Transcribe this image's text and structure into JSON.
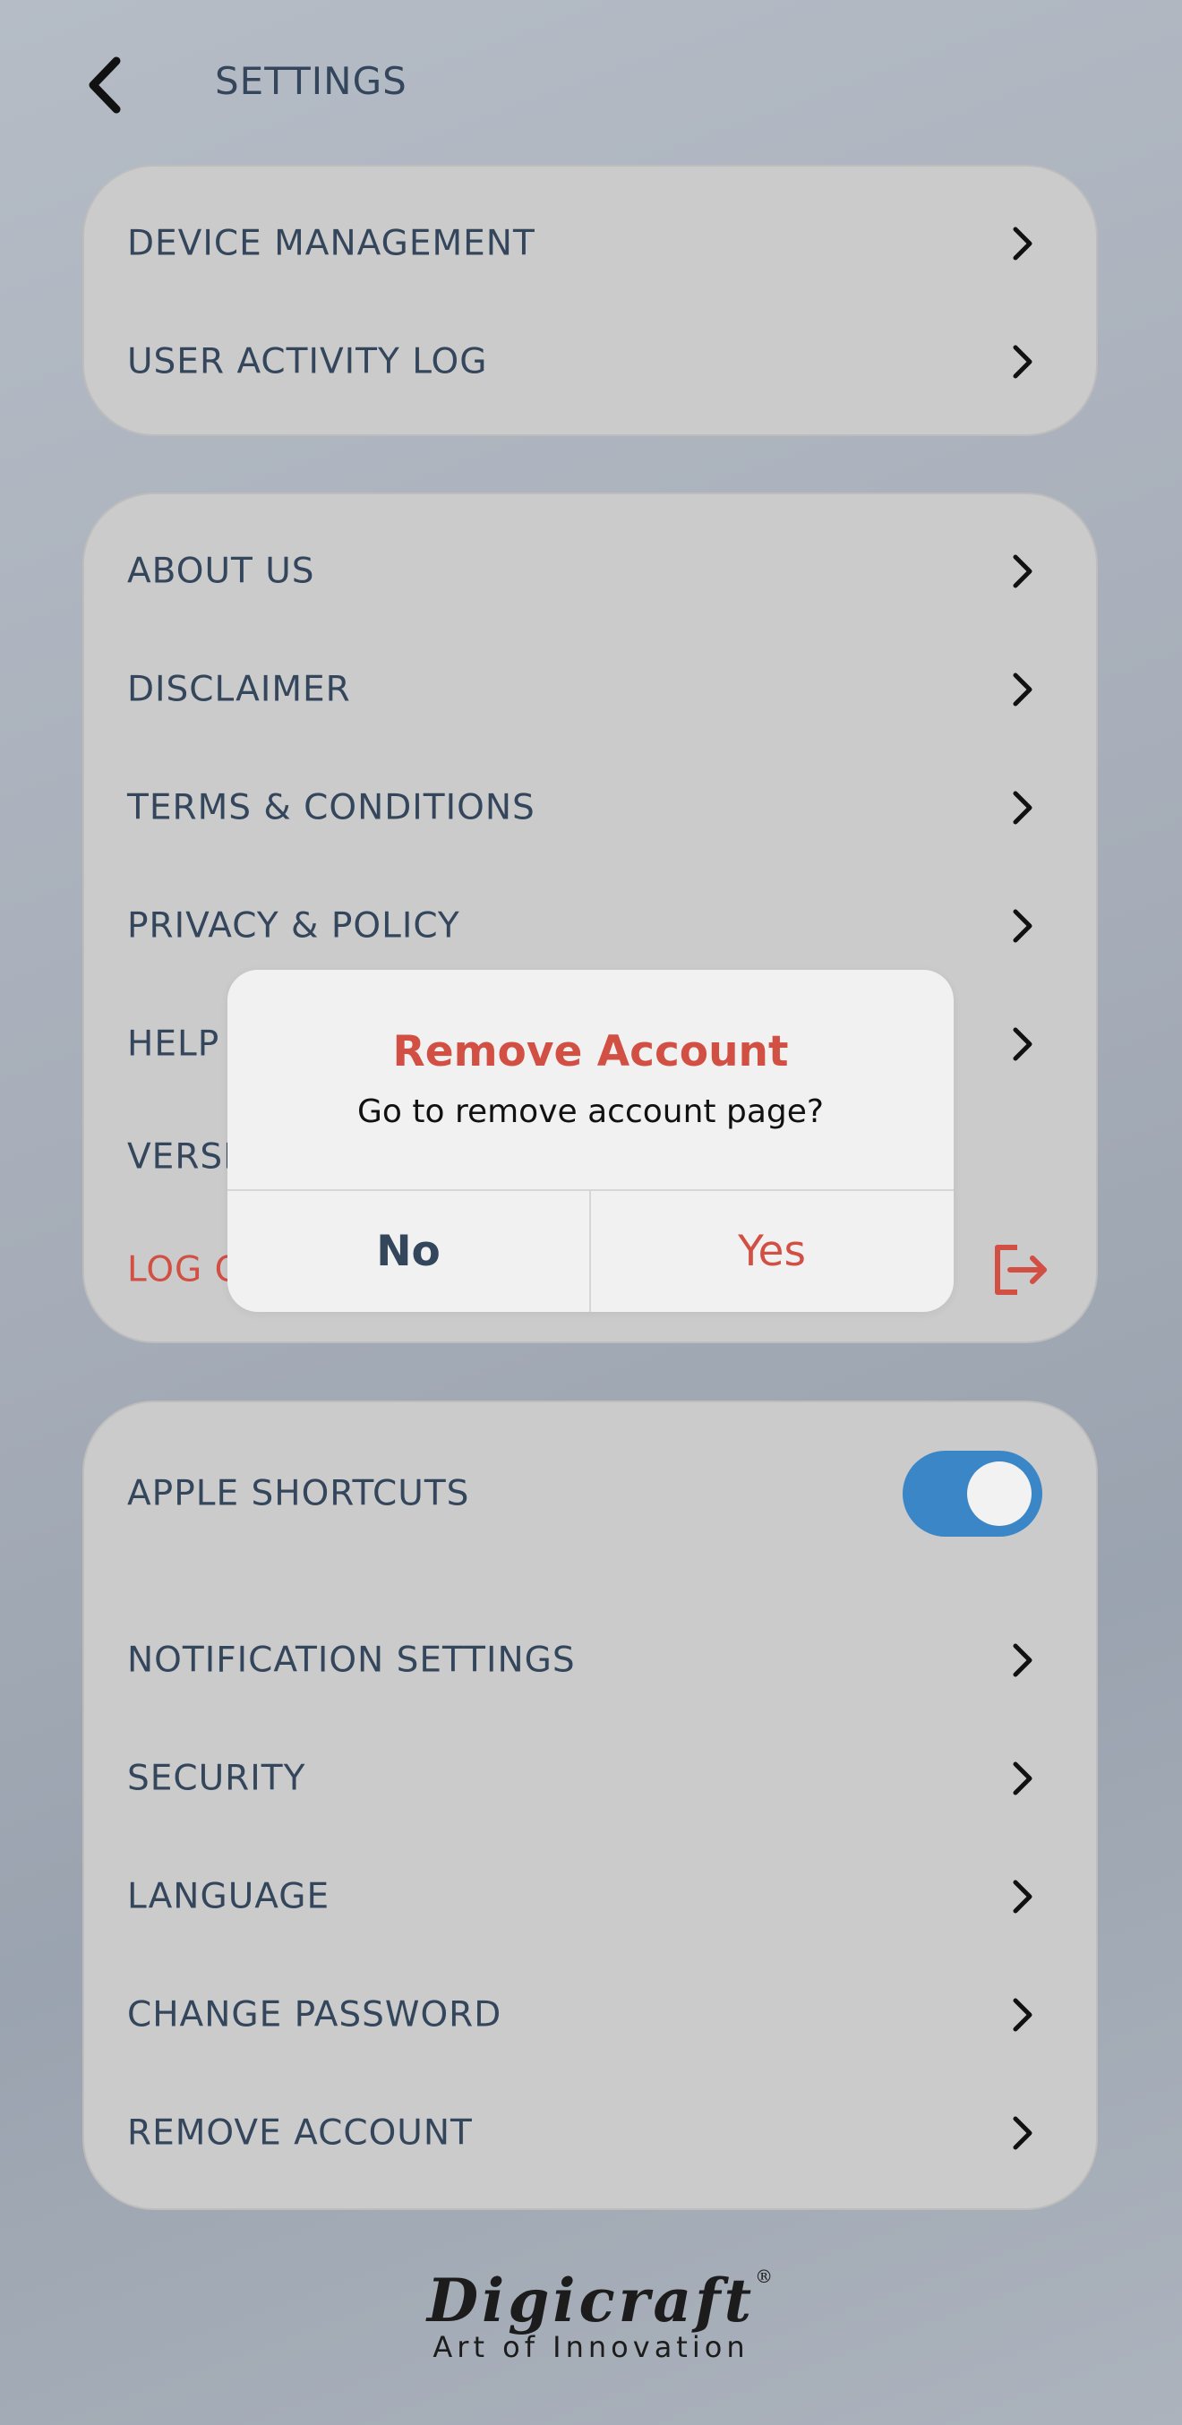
{
  "header": {
    "title": "SETTINGS"
  },
  "group1": {
    "items": [
      {
        "label": "DEVICE MANAGEMENT"
      },
      {
        "label": "USER ACTIVITY LOG"
      }
    ]
  },
  "group2": {
    "items": [
      {
        "label": "ABOUT US"
      },
      {
        "label": "DISCLAIMER"
      },
      {
        "label": "TERMS & CONDITIONS"
      },
      {
        "label": "PRIVACY & POLICY"
      },
      {
        "label": "HELP"
      },
      {
        "label": "VERSI"
      },
      {
        "label": "LOG O"
      }
    ]
  },
  "group3": {
    "apple_shortcuts": {
      "label": "APPLE SHORTCUTS",
      "enabled": true
    },
    "items": [
      {
        "label": "NOTIFICATION SETTINGS"
      },
      {
        "label": "SECURITY"
      },
      {
        "label": "LANGUAGE"
      },
      {
        "label": "CHANGE PASSWORD"
      },
      {
        "label": "REMOVE ACCOUNT"
      }
    ]
  },
  "dialog": {
    "title": "Remove Account",
    "message": "Go to remove account page?",
    "no_label": "No",
    "yes_label": "Yes"
  },
  "footer": {
    "brand": "Digicraft",
    "tagline": "Art of Innovation",
    "registered": "®"
  },
  "icons": {
    "back": "chevron-left-icon",
    "row": "chevron-right-icon",
    "logout": "logout-icon"
  },
  "colors": {
    "accent": "#d24f43",
    "text": "#34465c",
    "toggle_on": "#3a86c6"
  }
}
